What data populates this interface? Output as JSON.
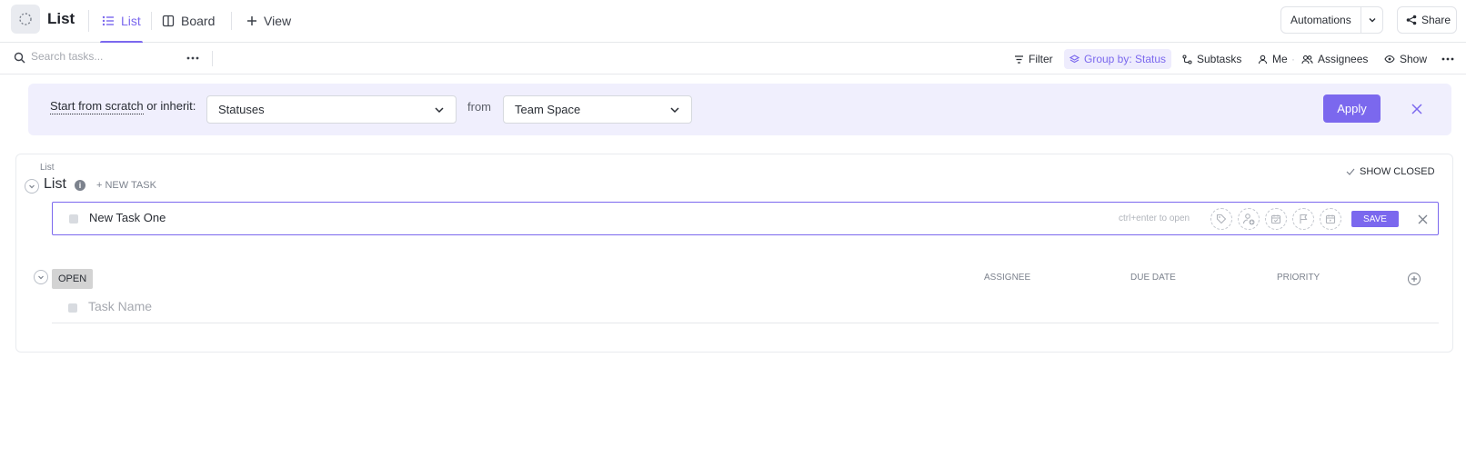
{
  "header": {
    "title": "List",
    "views": [
      {
        "label": "List",
        "icon": "list-icon",
        "active": true
      },
      {
        "label": "Board",
        "icon": "board-icon",
        "active": false
      },
      {
        "label": "View",
        "icon": "plus-icon",
        "active": false
      }
    ],
    "automations_label": "Automations",
    "share_label": "Share"
  },
  "toolbar": {
    "search_placeholder": "Search tasks...",
    "filter_label": "Filter",
    "group_by_label": "Group by: Status",
    "subtasks_label": "Subtasks",
    "me_label": "Me",
    "assignees_label": "Assignees",
    "show_label": "Show"
  },
  "banner": {
    "label_dotted": "Start from scratch",
    "label_rest": " or inherit:",
    "status_select": "Statuses",
    "from_label": "from",
    "space_select": "Team Space",
    "apply_label": "Apply"
  },
  "list": {
    "breadcrumb": "List",
    "name": "List",
    "info_glyph": "i",
    "new_task_link": "+ NEW TASK",
    "show_closed_label": "SHOW CLOSED",
    "new_task": {
      "value": "New Task One",
      "hint": "ctrl+enter to open",
      "save_label": "SAVE"
    },
    "group": {
      "status": "OPEN",
      "columns": [
        "ASSIGNEE",
        "DUE DATE",
        "PRIORITY"
      ],
      "task_placeholder": "Task Name"
    }
  },
  "colors": {
    "accent": "#7b68ee",
    "banner_bg": "#f0effd",
    "status_open": "#d3d3d3"
  }
}
